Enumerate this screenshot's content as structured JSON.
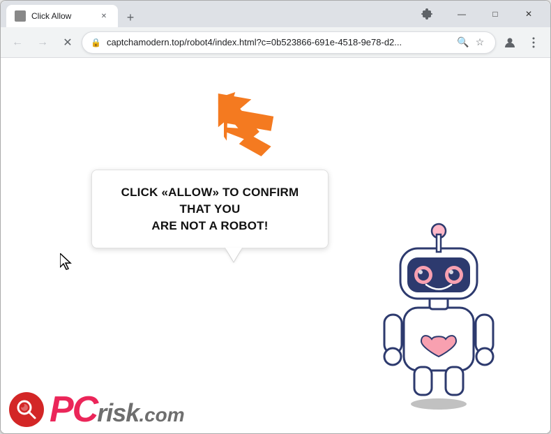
{
  "browser": {
    "tab": {
      "title": "Click Allow",
      "favicon": "🔒"
    },
    "new_tab_label": "+",
    "window_controls": {
      "minimize": "—",
      "maximize": "□",
      "close": "✕"
    },
    "nav": {
      "back_label": "←",
      "forward_label": "→",
      "reload_label": "✕",
      "address": "captchamodern.top/robot4/index.html?c=0b523866-691e-4518-9e78-d2...",
      "lock_icon": "🔒",
      "search_icon": "🔍",
      "star_icon": "☆",
      "profile_icon": "👤",
      "menu_icon": "⋮",
      "extension_icon": "🧩"
    }
  },
  "page": {
    "bubble_text_line1": "CLICK «ALLOW» TO CONFIRM THAT YOU",
    "bubble_text_line2": "ARE NOT A ROBOT!",
    "watermark": {
      "pc": "PC",
      "risk": "risk",
      "dotcom": ".com"
    }
  },
  "colors": {
    "orange_arrow": "#f47a20",
    "accent_red": "#e8003d",
    "bubble_border": "#e0e0e0",
    "chrome_bg": "#dee1e6",
    "address_bg": "#ffffff"
  }
}
